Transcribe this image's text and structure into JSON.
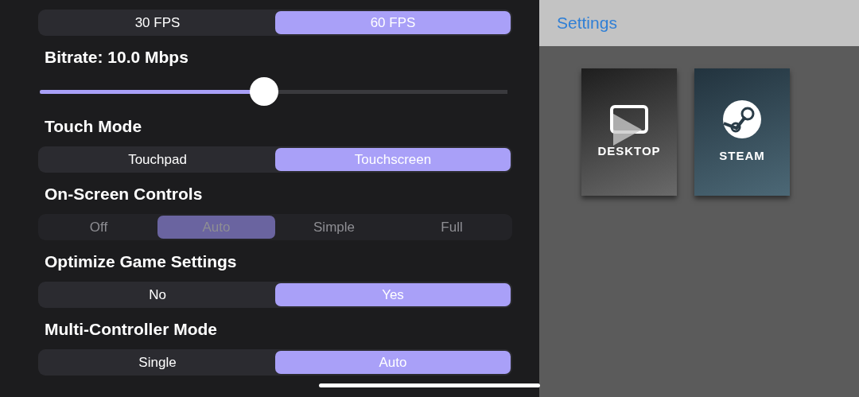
{
  "settings": [
    {
      "kind": "segmented",
      "disabled": false,
      "options": [
        {
          "label": "30 FPS",
          "selected": false
        },
        {
          "label": "60 FPS",
          "selected": true
        }
      ]
    },
    {
      "kind": "slider",
      "label": "Bitrate: 10.0 Mbps",
      "level": 0.48
    },
    {
      "kind": "segmented",
      "label": "Touch Mode",
      "disabled": false,
      "options": [
        {
          "label": "Touchpad",
          "selected": false
        },
        {
          "label": "Touchscreen",
          "selected": true
        }
      ]
    },
    {
      "kind": "segmented",
      "label": "On-Screen Controls",
      "disabled": true,
      "options": [
        {
          "label": "Off",
          "selected": false
        },
        {
          "label": "Auto",
          "selected": true
        },
        {
          "label": "Simple",
          "selected": false
        },
        {
          "label": "Full",
          "selected": false
        }
      ]
    },
    {
      "kind": "segmented",
      "label": "Optimize Game Settings",
      "disabled": false,
      "options": [
        {
          "label": "No",
          "selected": false
        },
        {
          "label": "Yes",
          "selected": true
        }
      ]
    },
    {
      "kind": "segmented",
      "label": "Multi-Controller Mode",
      "disabled": false,
      "options": [
        {
          "label": "Single",
          "selected": false
        },
        {
          "label": "Auto",
          "selected": true
        }
      ]
    }
  ],
  "nav_bar": {
    "title": "Settings"
  },
  "apps": [
    {
      "kind": "desktop",
      "label": "DESKTOP"
    },
    {
      "kind": "steam",
      "label": "STEAM"
    }
  ]
}
